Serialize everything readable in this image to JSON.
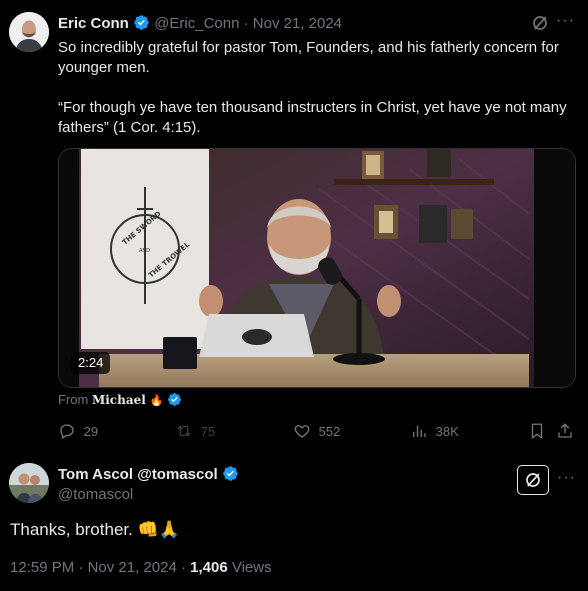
{
  "post": {
    "author_name": "Eric Conn",
    "handle": "@Eric_Conn",
    "separator": "·",
    "date": "Nov 21, 2024",
    "text_line1": "So incredibly grateful for pastor Tom, Founders, and his fatherly concern for younger men.",
    "text_line2": "“For though ye have ten thousand instructers in Christ, yet have ye not many fathers” (1 Cor. 4:15).",
    "video": {
      "duration": "2:24",
      "banner_top": "THE SWORD",
      "banner_bottom": "THE TROWEL",
      "banner_middle": "AND"
    },
    "from_label": "From",
    "from_source": "Michael",
    "from_source_emoji": "🔥",
    "actions": {
      "replies": "29",
      "reposts": "75",
      "likes": "552",
      "views": "38K"
    }
  },
  "reply": {
    "author_name": "Tom Ascol",
    "author_handle_inline": "@tomascol",
    "handle": "@tomascol",
    "text": "Thanks, brother. 👊🙏",
    "time": "12:59 PM",
    "separator1": "·",
    "date": "Nov 21, 2024",
    "separator2": "·",
    "views_count": "1,406",
    "views_label": "Views"
  },
  "colors": {
    "background": "#000000",
    "text_primary": "#e7e9ea",
    "text_secondary": "#71767b",
    "verified_blue": "#1d9bf0"
  },
  "icons": [
    "grok-icon",
    "more-icon",
    "verified-badge-icon",
    "reply-icon",
    "repost-icon",
    "like-icon",
    "views-icon",
    "bookmark-icon",
    "share-icon"
  ]
}
